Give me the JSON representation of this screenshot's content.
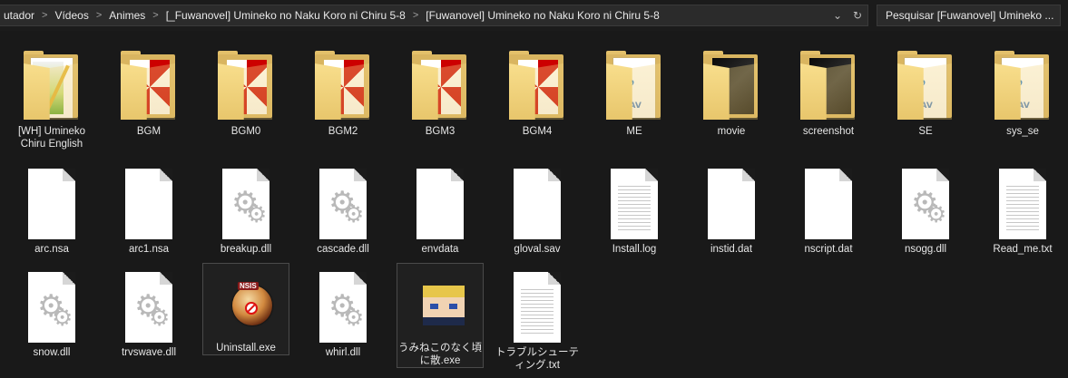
{
  "address_bar": {
    "crumbs": [
      "utador",
      "Vídeos",
      "Animes",
      "[_Fuwanovel] Umineko no Naku Koro ni Chiru 5-8",
      "[Fuwanovel] Umineko no Naku Koro ni Chiru 5-8"
    ],
    "chevron_glyph": "⌄",
    "refresh_glyph": "↻"
  },
  "search": {
    "placeholder": "Pesquisar [Fuwanovel] Umineko ..."
  },
  "items": [
    {
      "label": "[WH] Umineko Chiru English",
      "kind": "folder",
      "thumb": "image"
    },
    {
      "label": "BGM",
      "kind": "folder",
      "thumb": "umbrella"
    },
    {
      "label": "BGM0",
      "kind": "folder",
      "thumb": "umbrella"
    },
    {
      "label": "BGM2",
      "kind": "folder",
      "thumb": "umbrella"
    },
    {
      "label": "BGM3",
      "kind": "folder",
      "thumb": "umbrella"
    },
    {
      "label": "BGM4",
      "kind": "folder",
      "thumb": "umbrella"
    },
    {
      "label": "ME",
      "kind": "folder",
      "thumb": "audio"
    },
    {
      "label": "movie",
      "kind": "folder",
      "thumb": "dark"
    },
    {
      "label": "screenshot",
      "kind": "folder",
      "thumb": "dark"
    },
    {
      "label": "SE",
      "kind": "folder",
      "thumb": "audio"
    },
    {
      "label": "sys_se",
      "kind": "folder",
      "thumb": "audio"
    },
    {
      "label": "arc.nsa",
      "kind": "file-blank"
    },
    {
      "label": "arc1.nsa",
      "kind": "file-blank"
    },
    {
      "label": "breakup.dll",
      "kind": "file-gear"
    },
    {
      "label": "cascade.dll",
      "kind": "file-gear"
    },
    {
      "label": "envdata",
      "kind": "file-blank"
    },
    {
      "label": "gloval.sav",
      "kind": "file-blank"
    },
    {
      "label": "Install.log",
      "kind": "file-text"
    },
    {
      "label": "instid.dat",
      "kind": "file-blank"
    },
    {
      "label": "nscript.dat",
      "kind": "file-blank"
    },
    {
      "label": "nsogg.dll",
      "kind": "file-gear"
    },
    {
      "label": "Read_me.txt",
      "kind": "file-text"
    },
    {
      "label": "snow.dll",
      "kind": "file-gear"
    },
    {
      "label": "trvswave.dll",
      "kind": "file-gear"
    },
    {
      "label": "Uninstall.exe",
      "kind": "exe-uninstall"
    },
    {
      "label": "whirl.dll",
      "kind": "file-gear"
    },
    {
      "label": "うみねこのなく頃に散.exe",
      "kind": "exe-portrait"
    },
    {
      "label": "トラブルシューティング.txt",
      "kind": "file-text"
    }
  ],
  "icon_text": {
    "wav_tag": "WAV",
    "nsis_tag": "NSIS",
    "note_glyph": "♪",
    "gear_glyph": "⚙"
  }
}
